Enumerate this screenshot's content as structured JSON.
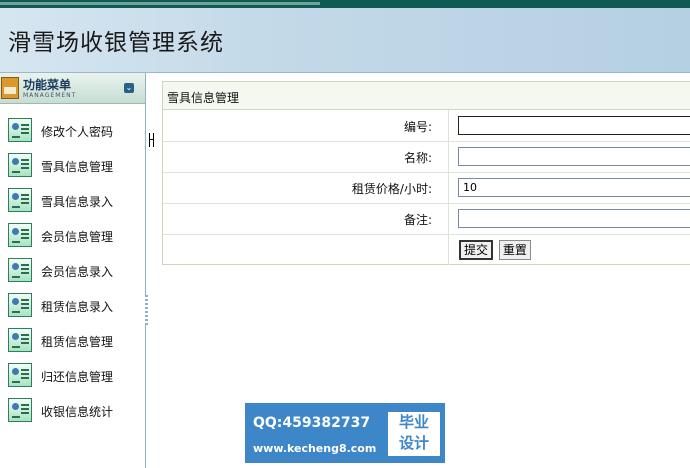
{
  "app": {
    "title": "滑雪场收银管理系统"
  },
  "sidebar": {
    "title": "功能菜单",
    "subtitle": "MANAGEMENT",
    "items": [
      {
        "label": "修改个人密码"
      },
      {
        "label": "雪具信息管理"
      },
      {
        "label": "雪具信息录入"
      },
      {
        "label": "会员信息管理"
      },
      {
        "label": "会员信息录入"
      },
      {
        "label": "租赁信息录入"
      },
      {
        "label": "租赁信息管理"
      },
      {
        "label": "归还信息管理"
      },
      {
        "label": "收银信息统计"
      }
    ]
  },
  "form": {
    "title": "雪具信息管理",
    "fields": [
      {
        "label": "编号:",
        "value": ""
      },
      {
        "label": "名称:",
        "value": ""
      },
      {
        "label": "租赁价格/小时:",
        "value": "10"
      },
      {
        "label": "备注:",
        "value": ""
      }
    ],
    "submit_label": "提交",
    "reset_label": "重置"
  },
  "watermark": {
    "qq": "QQ:459382737",
    "url": "www.kecheng8.com",
    "badge_line1": "毕业",
    "badge_line2": "设计"
  },
  "colors": {
    "header_bg": "#c3d9e8",
    "top_strip": "#0f5a52",
    "watermark_bg": "#3d86c8"
  }
}
